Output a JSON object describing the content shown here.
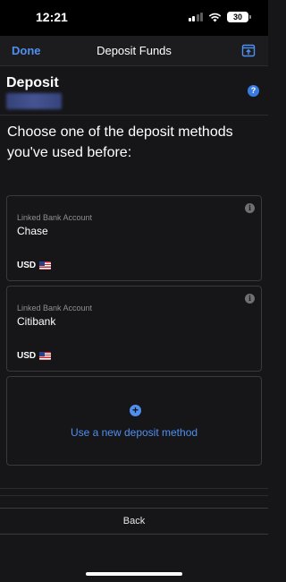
{
  "status_bar": {
    "time": "12:21",
    "battery": "30",
    "icons": [
      "signal-icon",
      "wifi-icon",
      "battery-icon"
    ]
  },
  "nav": {
    "done_label": "Done",
    "title": "Deposit Funds",
    "action_icon": "screen-share-icon"
  },
  "header": {
    "heading": "Deposit",
    "help_icon": "help-icon",
    "help_glyph": "?"
  },
  "prompt": "Choose one of the deposit methods you've used before:",
  "methods": [
    {
      "type": "Linked Bank Account",
      "name": "Chase",
      "currency": "USD",
      "flag": "us-flag-icon"
    },
    {
      "type": "Linked Bank Account",
      "name": "Citibank",
      "currency": "USD",
      "flag": "us-flag-icon"
    }
  ],
  "new_method": {
    "label": "Use a new deposit method",
    "icon": "plus-icon"
  },
  "back_label": "Back",
  "colors": {
    "accent": "#4f8ff0",
    "background": "#161619",
    "nav_background": "#1c1c1f"
  }
}
